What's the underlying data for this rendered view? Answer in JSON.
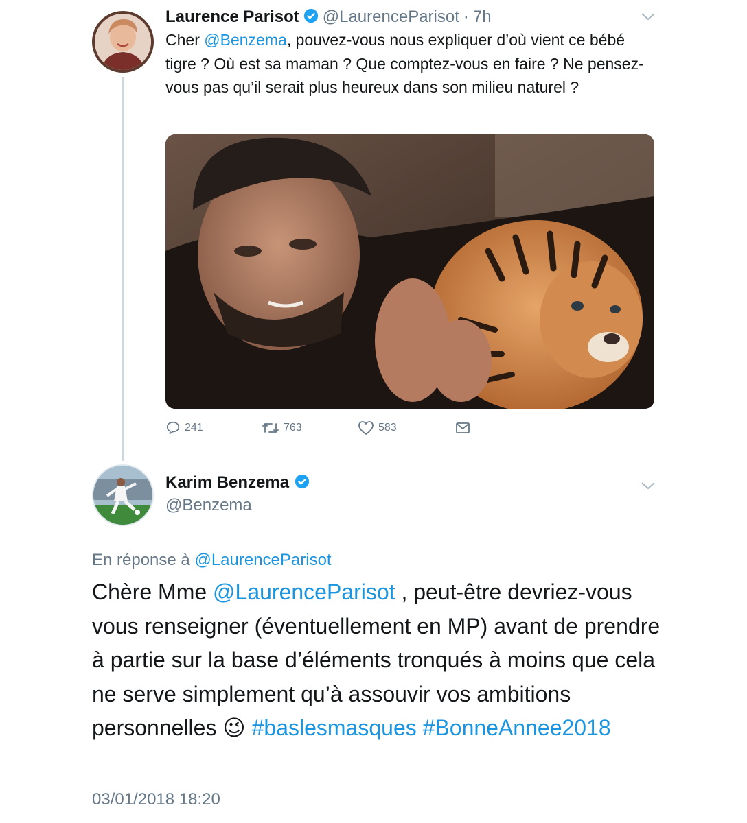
{
  "colors": {
    "link": "#1b95e0",
    "muted": "#657786",
    "text": "#14171a",
    "verified": "#1da1f2"
  },
  "first_tweet": {
    "author_name": "Laurence Parisot",
    "author_handle": "@LaurenceParisot",
    "separator": "·",
    "time": "7h",
    "text_parts": {
      "prefix": "Cher ",
      "mention": "@Benzema",
      "body": ", pouvez-vous nous expliquer d’où vient ce bébé tigre ? Où est sa maman ? Que comptez-vous en faire ? Ne pensez-vous pas qu’il serait plus heureux dans son milieu naturel ?"
    },
    "actions": {
      "replies": "241",
      "retweets": "763",
      "likes": "583"
    },
    "icons": [
      "verified-badge-icon",
      "chevron-down-icon",
      "reply-icon",
      "retweet-icon",
      "heart-icon",
      "message-icon"
    ]
  },
  "reply_tweet": {
    "author_name": "Karim Benzema",
    "author_handle": "@Benzema",
    "in_reply_label": "En réponse à",
    "in_reply_handle": "@LaurenceParisot",
    "text_parts": {
      "prefix": "Chère Mme ",
      "mention": "@LaurenceParisot",
      "body": " , peut-être devriez-vous vous renseigner (éventuellement en MP) avant de prendre à partie sur la base d’éléments tronqués à moins que cela ne serve simplement qu’à assouvir vos ambitions personnelles ",
      "emoji": "😉",
      "hashtag1": "#baslesmasques",
      "hashtag2": "#BonneAnnee2018"
    },
    "timestamp": "03/01/2018 18:20"
  }
}
